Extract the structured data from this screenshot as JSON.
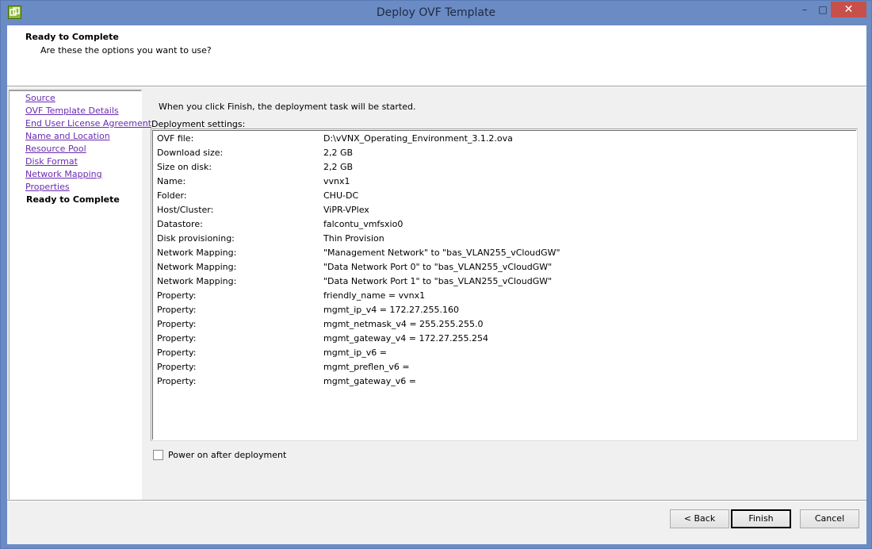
{
  "window": {
    "title": "Deploy OVF Template",
    "icon": "vsphere-app-icon",
    "controls": {
      "minimize": "–",
      "maximize": "□",
      "close": "✕"
    }
  },
  "header": {
    "title": "Ready to Complete",
    "subtitle": "Are these the options you want to use?"
  },
  "nav": {
    "items": [
      {
        "label": "Source"
      },
      {
        "label": "OVF Template Details"
      },
      {
        "label": "End User License Agreement"
      },
      {
        "label": "Name and Location"
      },
      {
        "label": "Resource Pool"
      },
      {
        "label": "Disk Format"
      },
      {
        "label": "Network Mapping"
      },
      {
        "label": "Properties"
      },
      {
        "label": "Ready to Complete"
      }
    ]
  },
  "main": {
    "intro": "When you click Finish, the deployment task will be started.",
    "settings_label": "Deployment settings:",
    "settings": [
      {
        "key": "OVF file:",
        "value": "D:\\vVNX_Operating_Environment_3.1.2.ova"
      },
      {
        "key": "Download size:",
        "value": "2,2 GB"
      },
      {
        "key": "Size on disk:",
        "value": "2,2 GB"
      },
      {
        "key": "Name:",
        "value": "vvnx1"
      },
      {
        "key": "Folder:",
        "value": "CHU-DC"
      },
      {
        "key": "Host/Cluster:",
        "value": "ViPR-VPlex"
      },
      {
        "key": "Datastore:",
        "value": "falcontu_vmfsxio0"
      },
      {
        "key": "Disk provisioning:",
        "value": "Thin Provision"
      },
      {
        "key": "Network Mapping:",
        "value": "\"Management Network\" to \"bas_VLAN255_vCloudGW\""
      },
      {
        "key": "Network Mapping:",
        "value": "\"Data Network Port 0\" to \"bas_VLAN255_vCloudGW\""
      },
      {
        "key": "Network Mapping:",
        "value": "\"Data Network Port 1\" to \"bas_VLAN255_vCloudGW\""
      },
      {
        "key": "Property:",
        "value": "friendly_name = vvnx1"
      },
      {
        "key": "Property:",
        "value": "mgmt_ip_v4 = 172.27.255.160"
      },
      {
        "key": "Property:",
        "value": "mgmt_netmask_v4 = 255.255.255.0"
      },
      {
        "key": "Property:",
        "value": "mgmt_gateway_v4 = 172.27.255.254"
      },
      {
        "key": "Property:",
        "value": "mgmt_ip_v6 ="
      },
      {
        "key": "Property:",
        "value": "mgmt_preflen_v6 ="
      },
      {
        "key": "Property:",
        "value": "mgmt_gateway_v6 ="
      }
    ],
    "power_on_label": "Power on after deployment",
    "power_on_checked": false
  },
  "footer": {
    "back_label": "< Back",
    "finish_label": "Finish",
    "cancel_label": "Cancel"
  },
  "colors": {
    "title_bar": "#6b8bc4",
    "close_button": "#c7504a",
    "link": "#6a2bb0",
    "dialog_bg": "#f0f0f0"
  }
}
